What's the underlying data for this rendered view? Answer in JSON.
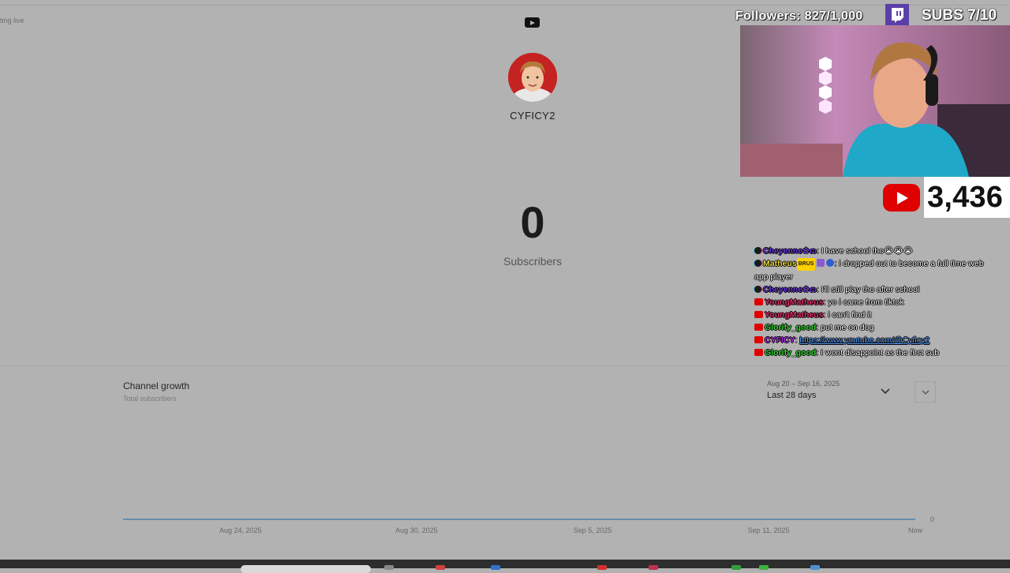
{
  "page": {
    "status_text": "ting live"
  },
  "profile": {
    "channel_name": "CYFICY2",
    "subscriber_count": "0",
    "subscriber_label": "Subscribers"
  },
  "growth": {
    "title": "Channel growth",
    "subtitle": "Total subscribers",
    "date_range": "Aug 20 – Sep 16, 2025",
    "range_label": "Last 28 days"
  },
  "chart_data": {
    "type": "line",
    "title": "Channel growth",
    "subtitle": "Total subscribers",
    "x_ticks": [
      "Aug 24, 2025",
      "Aug 30, 2025",
      "Sep 5, 2025",
      "Sep 11, 2025",
      "Now"
    ],
    "y_ticks": [
      "0"
    ],
    "x_range": [
      "Aug 20, 2025",
      "Sep 16, 2025"
    ],
    "ylim": [
      0,
      0
    ],
    "series": [
      {
        "x": [
          "Aug 20, 2025",
          "Sep 16, 2025"
        ],
        "values": [
          0,
          0
        ]
      }
    ],
    "color": "#4a7fa8",
    "grid": false
  },
  "overlay": {
    "followers": "Followers: 827/1,000",
    "subs": "SUBS 7/10",
    "youtube_subs": "3,436"
  },
  "chat": [
    {
      "platform": "tiktok",
      "user": "Cheyenne✿ɷ",
      "color": "#6a38d8",
      "text": ": I have school tho😭😭😭"
    },
    {
      "platform": "tiktok",
      "user": "Matheus",
      "color": "#e8d840",
      "badge": "BRUS",
      "extra_icons": true,
      "text": ": i dropped out to become a full time web app player"
    },
    {
      "platform": "tiktok",
      "user": "Cheyenne✿ɷ",
      "color": "#6a38d8",
      "text": ": I'll still play tho after school"
    },
    {
      "platform": "youtube",
      "user": "YoungMatheus",
      "color": "#e0306e",
      "text": ": yo i came from tiktok"
    },
    {
      "platform": "youtube",
      "user": "YoungMatheus",
      "color": "#e0306e",
      "text": ": i can't find it"
    },
    {
      "platform": "youtube",
      "user": "Glorify_good",
      "color": "#38d838",
      "text": ": put me on dog"
    },
    {
      "platform": "youtube",
      "user": "CYFICY",
      "color": "#b030e0",
      "text": ": ",
      "link": "https://www.youtube.com/@Cyficy2"
    },
    {
      "platform": "youtube",
      "user": "Glorify_good",
      "color": "#38d838",
      "text": ": I wont disappoint as the first sub"
    }
  ],
  "icons": {
    "youtube_small": "youtube-icon",
    "twitch": "twitch-icon",
    "youtube_logo": "youtube-logo-icon",
    "range_dropdown": "chevron-down-icon"
  }
}
